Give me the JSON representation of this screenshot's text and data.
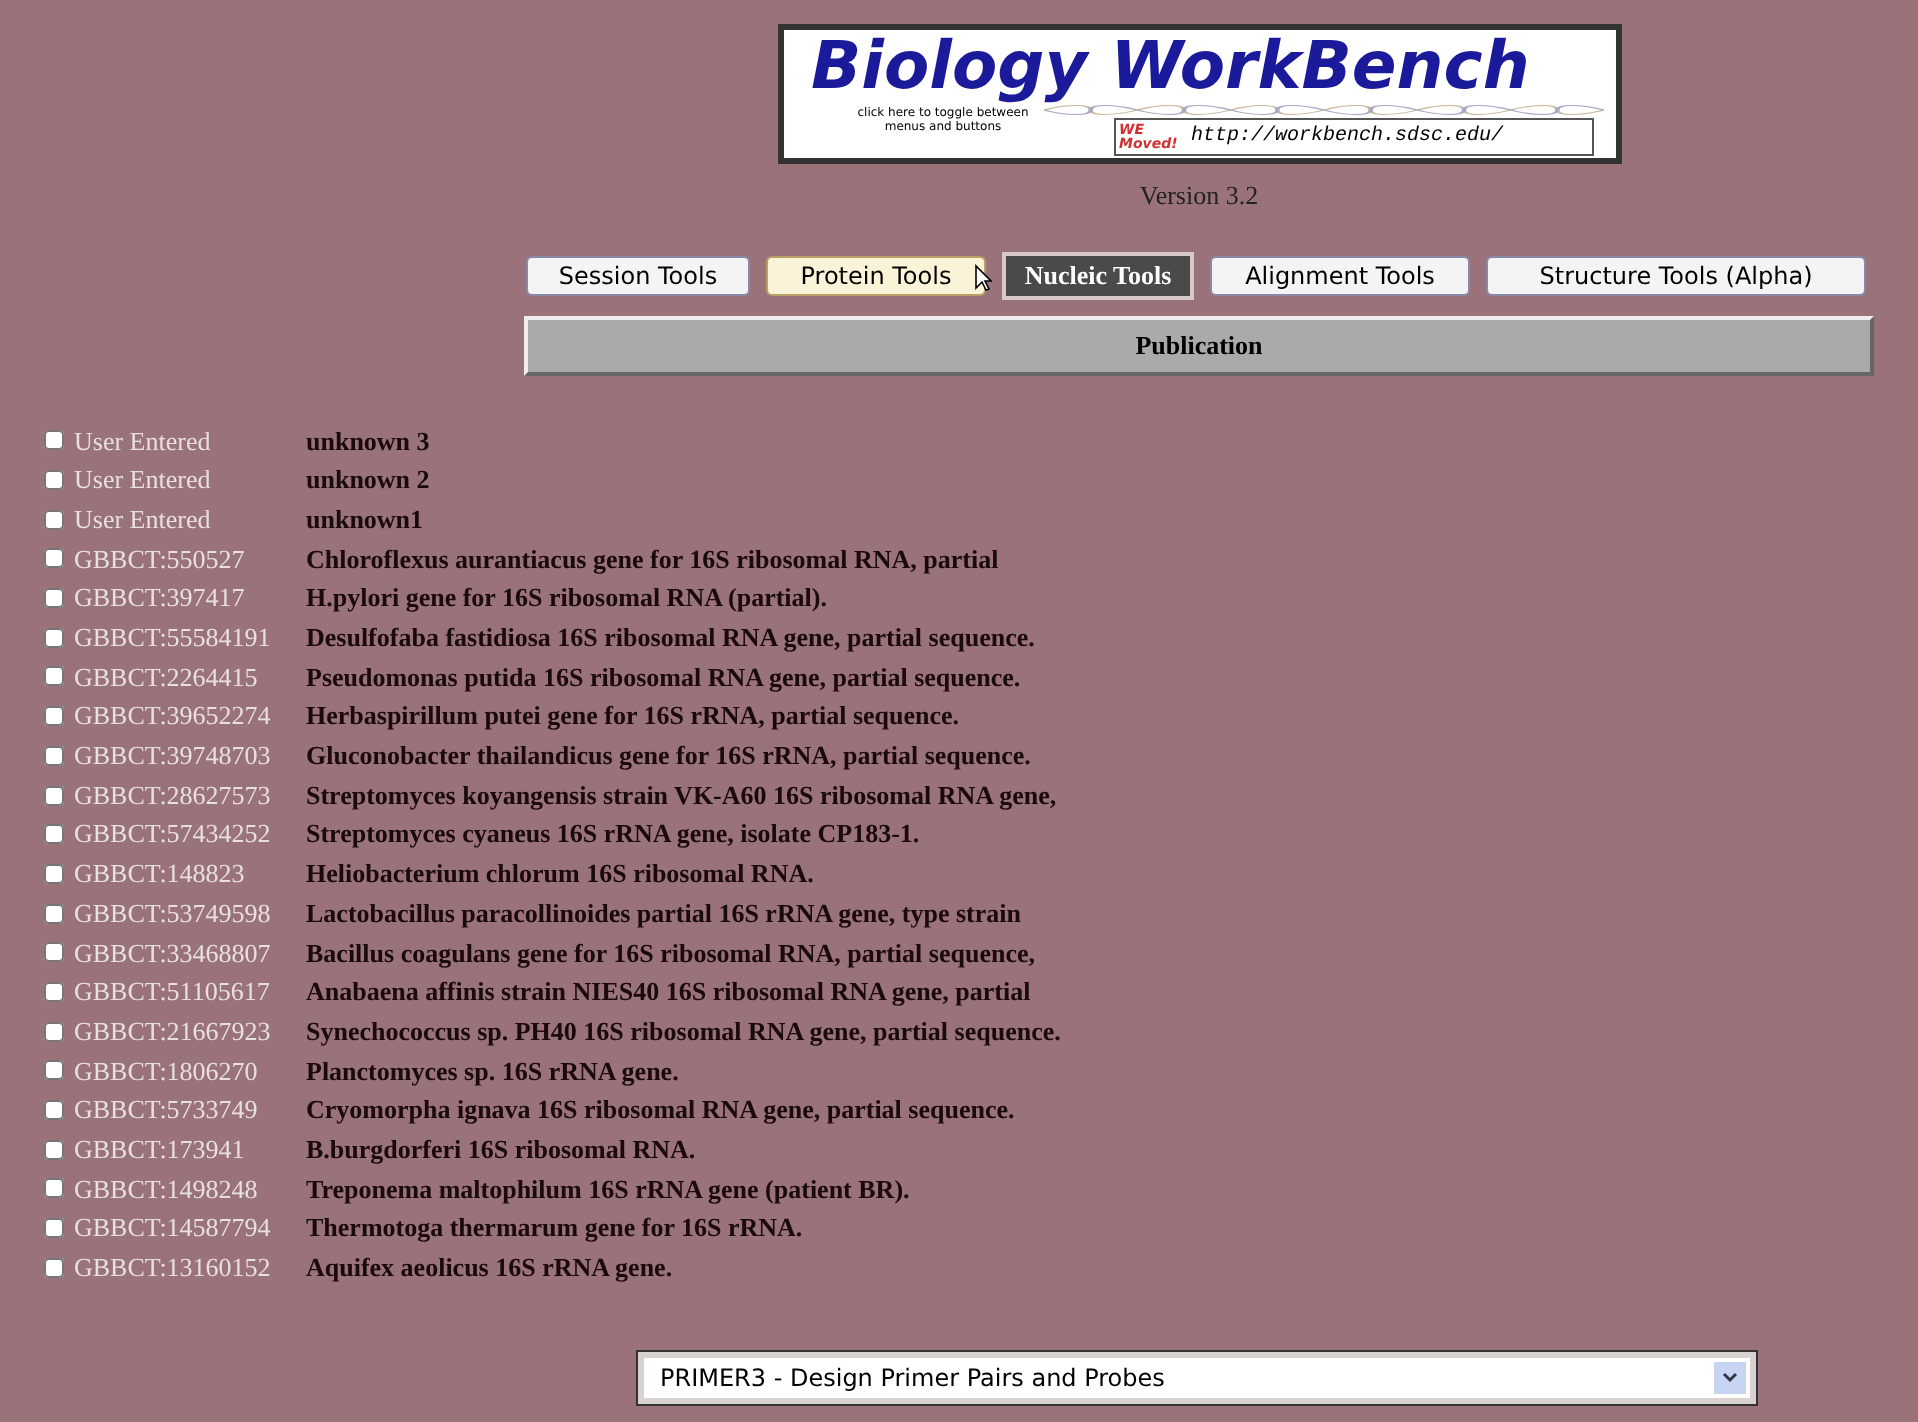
{
  "logo": {
    "title": "Biology WorkBench",
    "toggle_hint": "click here to toggle between menus and buttons",
    "moved_badge": "WE Moved!",
    "url": "http://workbench.sdsc.edu/"
  },
  "version": "Version 3.2",
  "tabs": [
    {
      "label": "Session Tools",
      "selected": false,
      "hovered": false
    },
    {
      "label": "Protein Tools",
      "selected": false,
      "hovered": true
    },
    {
      "label": "Nucleic Tools",
      "selected": true,
      "hovered": false
    },
    {
      "label": "Alignment Tools",
      "selected": false,
      "hovered": false
    },
    {
      "label": "Structure Tools (Alpha)",
      "selected": false,
      "hovered": false
    }
  ],
  "section_bar": "Publication",
  "sequences": [
    {
      "id": "User Entered",
      "description": "unknown 3",
      "checked": false
    },
    {
      "id": "User Entered",
      "description": "unknown 2",
      "checked": false
    },
    {
      "id": "User Entered",
      "description": "unknown1",
      "checked": false
    },
    {
      "id": "GBBCT:550527",
      "description": "Chloroflexus aurantiacus gene for 16S ribosomal RNA, partial",
      "checked": false
    },
    {
      "id": "GBBCT:397417",
      "description": "H.pylori gene for 16S ribosomal RNA (partial).",
      "checked": false
    },
    {
      "id": "GBBCT:55584191",
      "description": "Desulfofaba fastidiosa 16S ribosomal RNA gene, partial sequence.",
      "checked": false
    },
    {
      "id": "GBBCT:2264415",
      "description": "Pseudomonas putida 16S ribosomal RNA gene, partial sequence.",
      "checked": false
    },
    {
      "id": "GBBCT:39652274",
      "description": "Herbaspirillum putei gene for 16S rRNA, partial sequence.",
      "checked": false
    },
    {
      "id": "GBBCT:39748703",
      "description": "Gluconobacter thailandicus gene for 16S rRNA, partial sequence.",
      "checked": false
    },
    {
      "id": "GBBCT:28627573",
      "description": "Streptomyces koyangensis strain VK-A60 16S ribosomal RNA gene,",
      "checked": false
    },
    {
      "id": "GBBCT:57434252",
      "description": "Streptomyces cyaneus 16S rRNA gene, isolate CP183-1.",
      "checked": false
    },
    {
      "id": "GBBCT:148823",
      "description": "Heliobacterium chlorum 16S ribosomal RNA.",
      "checked": false
    },
    {
      "id": "GBBCT:53749598",
      "description": "Lactobacillus paracollinoides partial 16S rRNA gene, type strain",
      "checked": false
    },
    {
      "id": "GBBCT:33468807",
      "description": "Bacillus coagulans gene for 16S ribosomal RNA, partial sequence,",
      "checked": false
    },
    {
      "id": "GBBCT:51105617",
      "description": "Anabaena affinis strain NIES40 16S ribosomal RNA gene, partial",
      "checked": false
    },
    {
      "id": "GBBCT:21667923",
      "description": "Synechococcus sp. PH40 16S ribosomal RNA gene, partial sequence.",
      "checked": false
    },
    {
      "id": "GBBCT:1806270",
      "description": "Planctomyces sp. 16S rRNA gene.",
      "checked": false
    },
    {
      "id": "GBBCT:5733749",
      "description": "Cryomorpha ignava 16S ribosomal RNA gene, partial sequence.",
      "checked": false
    },
    {
      "id": "GBBCT:173941",
      "description": "B.burgdorferi 16S ribosomal RNA.",
      "checked": false
    },
    {
      "id": "GBBCT:1498248",
      "description": "Treponema maltophilum 16S rRNA gene (patient BR).",
      "checked": false
    },
    {
      "id": "GBBCT:14587794",
      "description": "Thermotoga thermarum gene for 16S rRNA.",
      "checked": false
    },
    {
      "id": "GBBCT:13160152",
      "description": "Aquifex aeolicus 16S rRNA gene.",
      "checked": false
    }
  ],
  "tool_select": {
    "value": "PRIMER3 - Design Primer Pairs and Probes"
  }
}
